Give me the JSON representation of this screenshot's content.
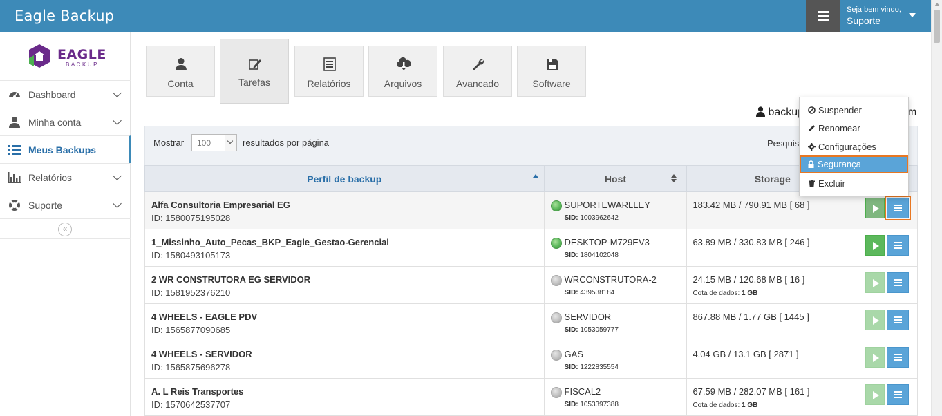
{
  "app": {
    "title": "Eagle Backup"
  },
  "header": {
    "welcome": "Seja bem vindo,",
    "user": "Suporte"
  },
  "logo": {
    "text": "EAGLE",
    "sub": "BACKUP"
  },
  "sidebar": {
    "items": [
      {
        "label": "Dashboard"
      },
      {
        "label": "Minha conta"
      },
      {
        "label": "Meus Backups"
      },
      {
        "label": "Relatórios"
      },
      {
        "label": "Suporte"
      }
    ],
    "collapse": "«"
  },
  "tabs": [
    {
      "label": "Conta"
    },
    {
      "label": "Tarefas"
    },
    {
      "label": "Relatórios"
    },
    {
      "label": "Arquivos"
    },
    {
      "label": "Avancado"
    },
    {
      "label": "Software"
    }
  ],
  "user_line": {
    "left": "backup",
    "right": "m"
  },
  "table_controls": {
    "show_label": "Mostrar",
    "per_page": "100",
    "results_label": "resultados por página",
    "search_label": "Pesquis"
  },
  "columns": {
    "profile": "Perfil de backup",
    "host": "Host",
    "storage": "Storage"
  },
  "rows": [
    {
      "name": "Alfa Consultoria Empresarial EG",
      "id": "ID: 1580075195028",
      "host": "SUPORTEWARLLEY",
      "sid_label": "SID:",
      "sid": "1003962642",
      "storage": "183.42 MB / 790.91 MB [ 68 ]",
      "status": "online"
    },
    {
      "name": "1_Missinho_Auto_Pecas_BKP_Eagle_Gestao-Gerencial",
      "id": "ID: 1580493105173",
      "host": "DESKTOP-M729EV3",
      "sid_label": "SID:",
      "sid": "1804102048",
      "storage": "63.89 MB / 330.83 MB [ 246 ]",
      "status": "online"
    },
    {
      "name": "2 WR CONSTRUTORA EG SERVIDOR",
      "id": "ID: 1581952376210",
      "host": "WRCONSTRUTORA-2",
      "sid_label": "SID:",
      "sid": "439538184",
      "storage": "24.15 MB / 120.68 MB [ 16 ]",
      "cota_label": "Cota de dados:",
      "cota": "1 GB",
      "status": "offline"
    },
    {
      "name": "4 WHEELS - EAGLE PDV",
      "id": "ID: 1565877090685",
      "host": "SERVIDOR",
      "sid_label": "SID:",
      "sid": "1053059777",
      "storage": "867.88 MB / 1.77 GB [ 1445 ]",
      "status": "offline"
    },
    {
      "name": "4 WHEELS - SERVIDOR",
      "id": "ID: 1565875696278",
      "host": "GAS",
      "sid_label": "SID:",
      "sid": "1222835554",
      "storage": "4.04 GB / 13.1 GB [ 2871 ]",
      "status": "offline"
    },
    {
      "name": "A. L Reis Transportes",
      "id": "ID: 1570642537707",
      "host": "FISCAL2",
      "sid_label": "SID:",
      "sid": "1053397388",
      "storage": "67.59 MB / 282.07 MB [ 161 ]",
      "cota_label": "Cota de dados:",
      "cota": "1 GB",
      "status": "offline"
    }
  ],
  "dropdown": {
    "items": [
      {
        "label": "Suspender",
        "icon": "ban-icon"
      },
      {
        "label": "Renomear",
        "icon": "pencil-icon"
      },
      {
        "label": "Configurações",
        "icon": "cog-icon"
      },
      {
        "label": "Segurança",
        "icon": "lock-icon"
      },
      {
        "label": "Excluir",
        "icon": "trash-icon"
      }
    ]
  },
  "colors": {
    "header": "#3d8ab8",
    "accent_blue": "#5aa4d8",
    "play_green": "#5cb85c",
    "focus_orange": "#e87722"
  }
}
